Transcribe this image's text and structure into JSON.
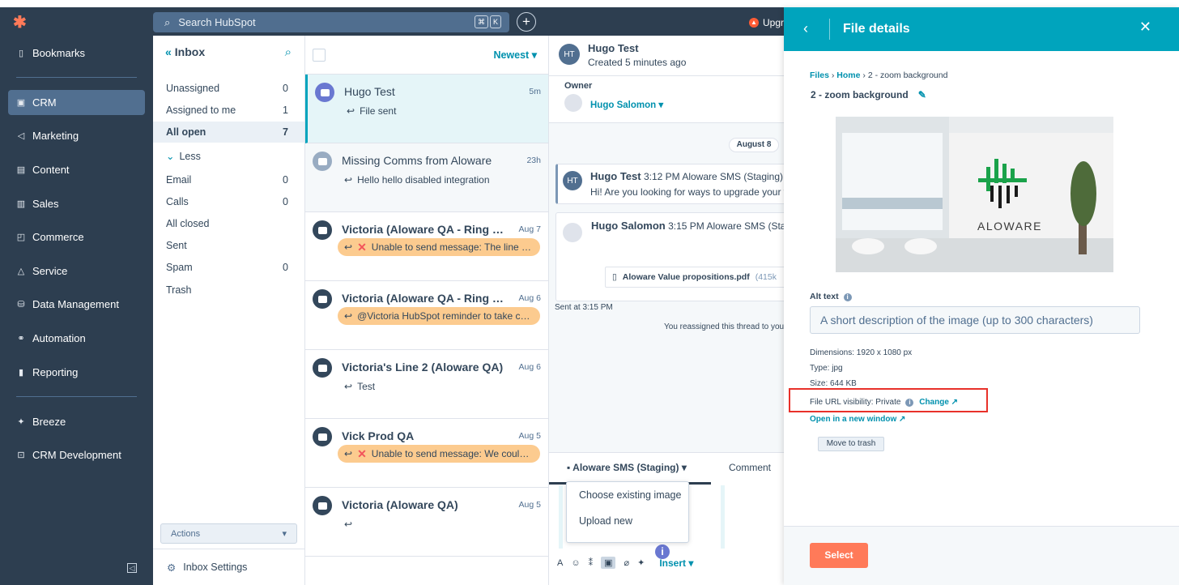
{
  "nav": {
    "items": [
      {
        "label": "Bookmarks",
        "icon": "bookmark-icon"
      },
      {
        "label": "CRM",
        "icon": "crm-icon"
      },
      {
        "label": "Marketing",
        "icon": "megaphone-icon"
      },
      {
        "label": "Content",
        "icon": "content-icon"
      },
      {
        "label": "Sales",
        "icon": "sales-icon"
      },
      {
        "label": "Commerce",
        "icon": "commerce-icon"
      },
      {
        "label": "Service",
        "icon": "service-icon"
      },
      {
        "label": "Data Management",
        "icon": "database-icon"
      },
      {
        "label": "Automation",
        "icon": "automation-icon"
      },
      {
        "label": "Reporting",
        "icon": "reporting-icon"
      },
      {
        "label": "Breeze",
        "icon": "sparkle-icon"
      },
      {
        "label": "CRM Development",
        "icon": "code-icon"
      }
    ]
  },
  "topbar": {
    "search_placeholder": "Search HubSpot",
    "kbd1": "⌘",
    "kbd2": "K",
    "upgrade": "Upgr"
  },
  "inbox": {
    "title": "Inbox",
    "rows": [
      {
        "label": "Unassigned",
        "count": "0"
      },
      {
        "label": "Assigned to me",
        "count": "1"
      },
      {
        "label": "All open",
        "count": "7"
      },
      {
        "label": "Less",
        "count": ""
      },
      {
        "label": "Email",
        "count": "0"
      },
      {
        "label": "Calls",
        "count": "0"
      },
      {
        "label": "All closed",
        "count": ""
      },
      {
        "label": "Sent",
        "count": ""
      },
      {
        "label": "Spam",
        "count": "0"
      },
      {
        "label": "Trash",
        "count": ""
      }
    ],
    "actions": "Actions",
    "settings": "Inbox Settings"
  },
  "threads": {
    "sort": "Newest",
    "items": [
      {
        "name": "Hugo Test",
        "time": "5m",
        "preview": "File sent"
      },
      {
        "name": "Missing Comms from Aloware",
        "time": "23h",
        "preview": "Hello hello disabled integration"
      },
      {
        "name": "Victoria (Aloware QA - Ring Gr...",
        "time": "Aug 7",
        "preview": "Unable to send message: The line us..."
      },
      {
        "name": "Victoria (Aloware QA - Ring Gr...",
        "time": "Aug 6",
        "preview": "@Victoria HubSpot reminder to take care"
      },
      {
        "name": "Victoria's Line 2 (Aloware QA)",
        "time": "Aug 6",
        "preview": "Test"
      },
      {
        "name": "Vick Prod QA",
        "time": "Aug 5",
        "preview": "Unable to send message: We could n..."
      },
      {
        "name": "Victoria (Aloware QA)",
        "time": "Aug 5",
        "preview": ""
      }
    ]
  },
  "conversation": {
    "initials": "HT",
    "name": "Hugo Test",
    "created": "Created 5 minutes ago",
    "owner_label": "Owner",
    "owner": "Hugo Salomon",
    "date": "August 8",
    "msg1": {
      "initials": "HT",
      "name": "Hugo Test",
      "time": "3:12 PM",
      "channel": "Aloware SMS (Staging)",
      "text": "Hi! Are you looking for ways to upgrade your w"
    },
    "msg2": {
      "name": "Hugo Salomon",
      "time": "3:15 PM",
      "channel": "Aloware SMS (Sta",
      "file": "Aloware Value propositions.pdf",
      "size": "(415k"
    },
    "sent": "Sent at 3:15 PM",
    "reassigned": "You reassigned this thread to you",
    "channel_tab": "Aloware SMS (Staging)",
    "comment_tab": "Comment",
    "menu": [
      "Choose existing image",
      "Upload new"
    ],
    "insert": "Insert"
  },
  "panel": {
    "title": "File details",
    "crumbs": [
      "Files",
      "Home",
      "2 - zoom background"
    ],
    "file_name": "2 - zoom background",
    "image_brand": "ALOWARE",
    "alt_label": "Alt text",
    "alt_placeholder": "A short description of the image (up to 300 characters)",
    "dimensions": "Dimensions: 1920 x 1080 px",
    "type": "Type: jpg",
    "size": "Size: 644 KB",
    "visibility": "File URL visibility: Private",
    "change": "Change",
    "open_new": "Open in a new window",
    "trash": "Move to trash",
    "select": "Select"
  }
}
